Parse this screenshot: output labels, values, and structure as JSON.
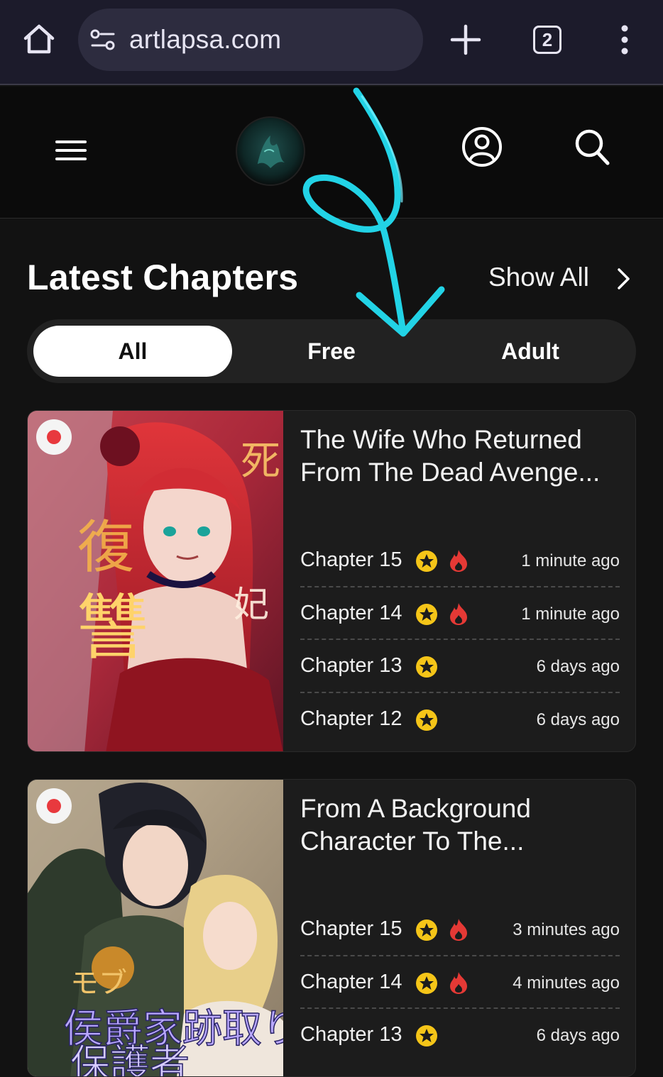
{
  "browser": {
    "url": "artlapsa.com",
    "tab_count": "2",
    "icons": [
      "home-icon",
      "tune-icon",
      "plus-icon",
      "tabs-icon",
      "kebab-menu-icon"
    ]
  },
  "header": {
    "icons": [
      "hamburger-menu-icon",
      "site-logo",
      "account-icon",
      "search-icon"
    ]
  },
  "section": {
    "title": "Latest Chapters",
    "show_all": "Show All"
  },
  "filters": {
    "all": "All",
    "free": "Free",
    "adult": "Adult",
    "active": "All"
  },
  "cards": [
    {
      "title": "The Wife Who Returned From The Dead Avenge...",
      "chapters": [
        {
          "name": "Chapter 15",
          "time": "1 minute ago",
          "hot": true
        },
        {
          "name": "Chapter 14",
          "time": "1 minute ago",
          "hot": true
        },
        {
          "name": "Chapter 13",
          "time": "6 days ago",
          "hot": false
        },
        {
          "name": "Chapter 12",
          "time": "6 days ago",
          "hot": false
        }
      ]
    },
    {
      "title": "From A Background Character To The...",
      "chapters": [
        {
          "name": "Chapter 15",
          "time": "3 minutes ago",
          "hot": true
        },
        {
          "name": "Chapter 14",
          "time": "4 minutes ago",
          "hot": true
        },
        {
          "name": "Chapter 13",
          "time": "6 days ago",
          "hot": false
        }
      ]
    }
  ],
  "colors": {
    "accent_annotation": "#22d3e6",
    "star": "#f5c518",
    "fire": "#e53935",
    "live_dot": "#e8393e"
  }
}
